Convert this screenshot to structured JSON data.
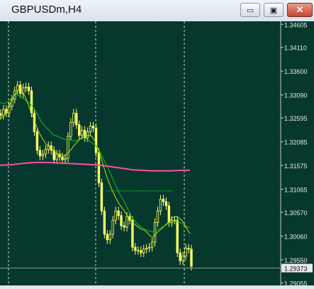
{
  "window": {
    "title": "GBPUSDm,H4",
    "minimize_glyph": "▭",
    "restore_glyph": "▣",
    "close_glyph": "✕"
  },
  "colors": {
    "background": "#07382e",
    "grid": "#d8d8a8",
    "axis": "#c8c8c8",
    "candle": "#ffff66",
    "ma_fast": "#b8e000",
    "ma_slow": "#10c020",
    "ma_long": "#ff4fa7",
    "price_tag_bg": "#e8e8e8"
  },
  "chart_data": {
    "type": "candlestick",
    "symbol": "GBPUSDm",
    "timeframe": "H4",
    "y_ticks": [
      "1.34605",
      "1.34110",
      "1.33600",
      "1.33090",
      "1.32595",
      "1.32085",
      "1.31575",
      "1.31065",
      "1.30570",
      "1.30060",
      "1.29550",
      "1.29055"
    ],
    "ylim": [
      1.29,
      1.3467
    ],
    "current_price": "1.29373",
    "close": [
      1.3265,
      1.3278,
      1.327,
      1.3285,
      1.33,
      1.3318,
      1.333,
      1.3312,
      1.3324,
      1.3326,
      1.3318,
      1.327,
      1.323,
      1.319,
      1.3178,
      1.3182,
      1.3192,
      1.32,
      1.319,
      1.317,
      1.3182,
      1.3176,
      1.317,
      1.3173,
      1.322,
      1.325,
      1.327,
      1.3245,
      1.3222,
      1.3233,
      1.3217,
      1.323,
      1.3242,
      1.3238,
      1.3185,
      1.312,
      1.306,
      1.301,
      1.2998,
      1.301,
      1.304,
      1.306,
      1.305,
      1.3028,
      1.3025,
      1.3048,
      1.304,
      1.2982,
      1.2975,
      1.2975,
      1.297,
      1.2978,
      1.298,
      1.2982,
      1.2993,
      1.3035,
      1.306,
      1.3085,
      1.308,
      1.3071,
      1.3035,
      1.304,
      1.304,
      1.297,
      1.2953,
      1.2963,
      1.298,
      1.2978,
      1.2941
    ],
    "ma_fast": [
      1.3258,
      1.3262,
      1.327,
      1.3285,
      1.33,
      1.3312,
      1.3318,
      1.3316,
      1.3308,
      1.3292,
      1.3274,
      1.3258,
      1.324,
      1.3225,
      1.3214,
      1.3204,
      1.3198,
      1.3193,
      1.3186,
      1.3181,
      1.318,
      1.3178,
      1.3183,
      1.319,
      1.3199,
      1.3206,
      1.3214,
      1.3218,
      1.3222,
      1.3222,
      1.322,
      1.321,
      1.3193,
      1.3174,
      1.3151,
      1.3131,
      1.3114,
      1.3099,
      1.3085,
      1.3074,
      1.3065,
      1.3056,
      1.3044,
      1.3037,
      1.3031,
      1.3026,
      1.3021,
      1.3019,
      1.3014,
      1.3006,
      1.3004,
      1.3012,
      1.3018,
      1.3023,
      1.303,
      1.3036,
      1.3044,
      1.3048,
      1.3047,
      1.3042,
      1.3034,
      1.3022,
      1.3011
    ],
    "ma_slow": [
      1.3293,
      1.329,
      1.3295,
      1.3303,
      1.331,
      1.3305,
      1.3299,
      1.3293,
      1.3283,
      1.3269,
      1.3251,
      1.3241,
      1.3232,
      1.3223,
      1.322,
      1.3216,
      1.3213,
      1.3212,
      1.321,
      1.3212,
      1.3218,
      1.3213,
      1.3208,
      1.3202,
      1.319,
      1.3172,
      1.3155,
      1.3135,
      1.3115,
      1.3096,
      1.3081,
      1.3063,
      1.3046,
      1.3034,
      1.3026,
      1.3021,
      1.3017,
      1.3015,
      1.3019,
      1.3024,
      1.3028,
      1.3035,
      1.3038,
      1.3037,
      1.3034,
      1.3026,
      1.3024
    ],
    "ma_long": [
      1.3158,
      1.3159,
      1.3161,
      1.3163,
      1.3164,
      1.3164,
      1.3163,
      1.3162,
      1.3161,
      1.316,
      1.3159,
      1.3157,
      1.3154,
      1.3151,
      1.3148,
      1.3147,
      1.3146,
      1.3146,
      1.3146,
      1.3147,
      1.3147
    ]
  }
}
